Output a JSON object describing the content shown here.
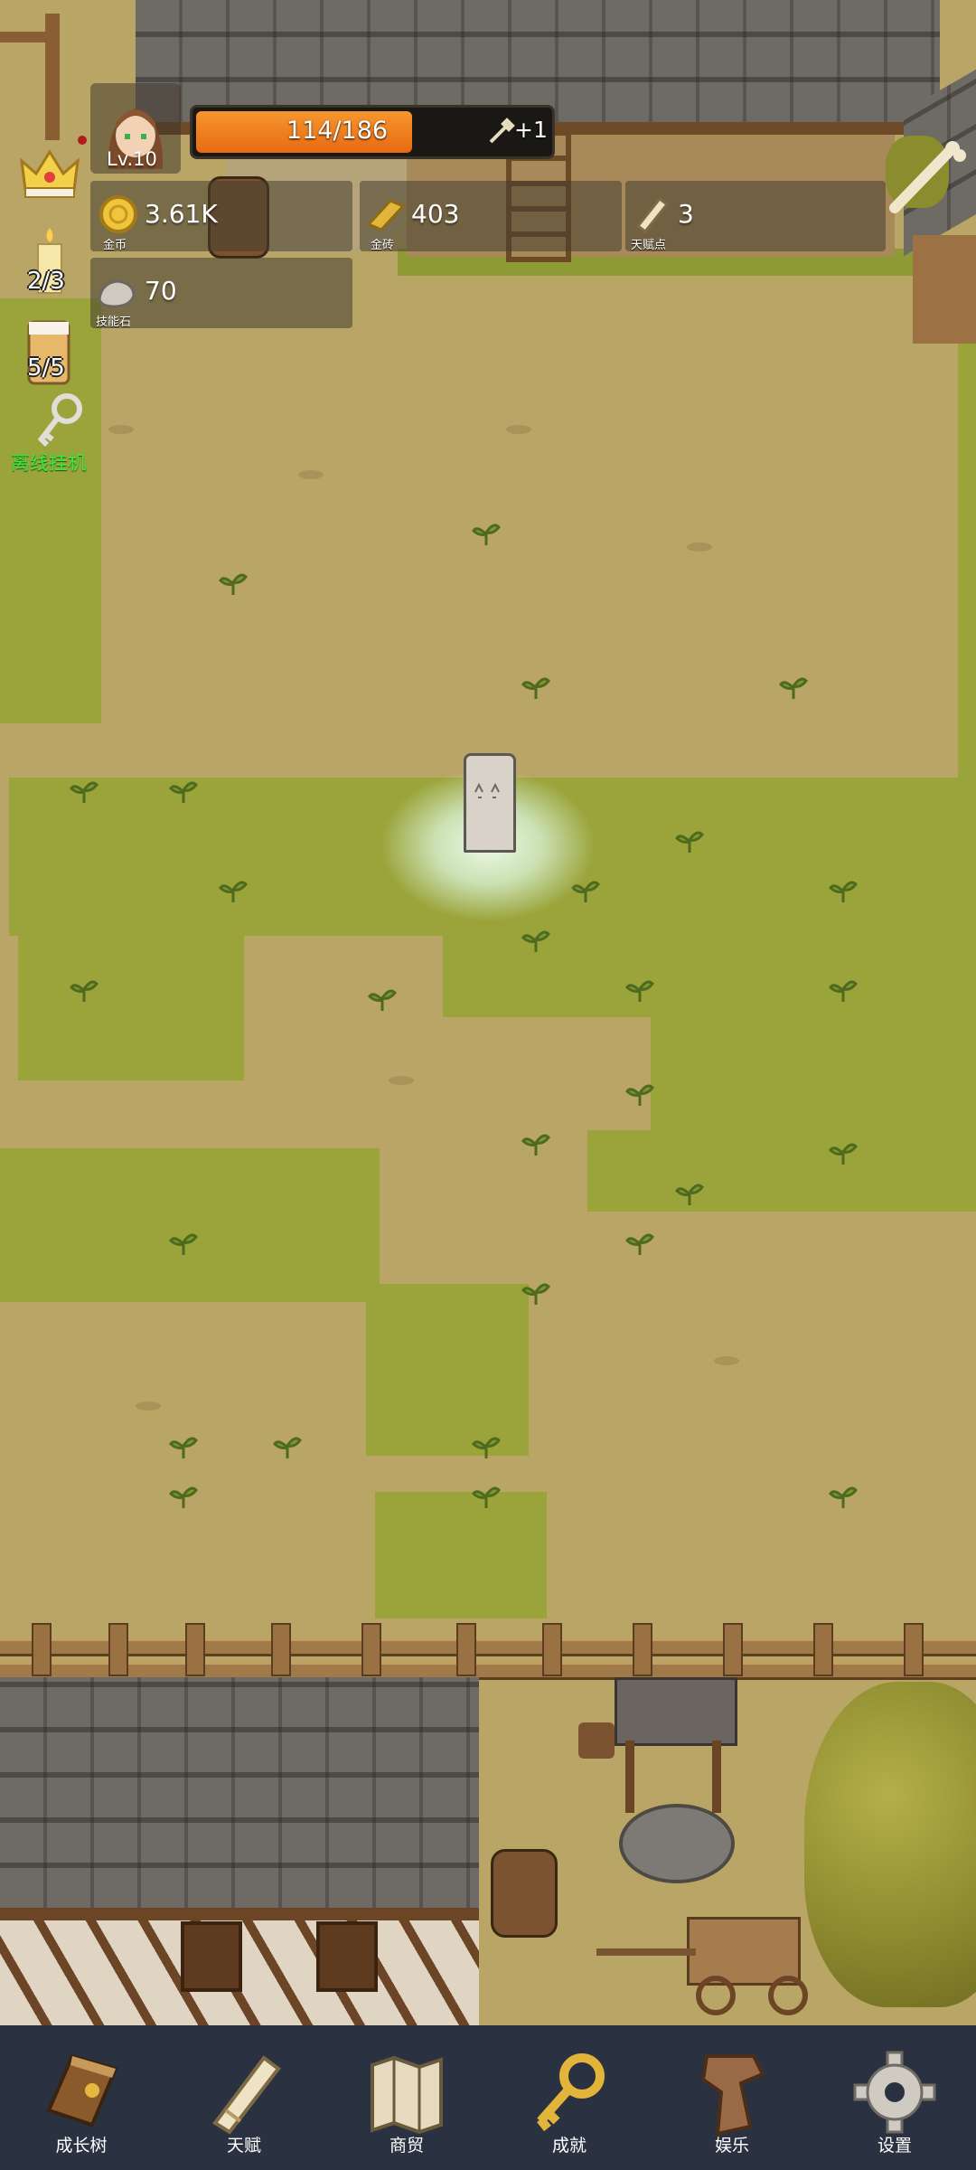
{
  "player": {
    "level": "Lv.10",
    "hp_text": "114/186",
    "hp_fraction": 0.613,
    "hp_bonus": "+1"
  },
  "resources": {
    "gold": {
      "value": "3.61K",
      "label": "金币",
      "icon": "gold-coin-icon"
    },
    "gold_brick": {
      "value": "403",
      "label": "金砖",
      "icon": "gold-brick-icon"
    },
    "talent_points": {
      "value": "3",
      "label": "天赋点",
      "icon": "scroll-icon"
    },
    "skill_stone": {
      "value": "70",
      "label": "技能石",
      "icon": "stone-icon"
    }
  },
  "left_bar": {
    "candle_count": "2/3",
    "drink_count": "5/5",
    "idle_label": "离线挂机"
  },
  "nav": [
    {
      "label": "成长树",
      "icon": "book-icon"
    },
    {
      "label": "天赋",
      "icon": "scroll-icon"
    },
    {
      "label": "商贸",
      "icon": "map-icon"
    },
    {
      "label": "成就",
      "icon": "key-icon"
    },
    {
      "label": "娱乐",
      "icon": "parchment-icon"
    },
    {
      "label": "设置",
      "icon": "gear-icon"
    }
  ],
  "colors": {
    "hp_bar": "#f07a1e",
    "nav_bg": "#2a3140",
    "grass": "#9aa43a",
    "dirt": "#b9a566",
    "idle_text": "#3ee83e"
  }
}
